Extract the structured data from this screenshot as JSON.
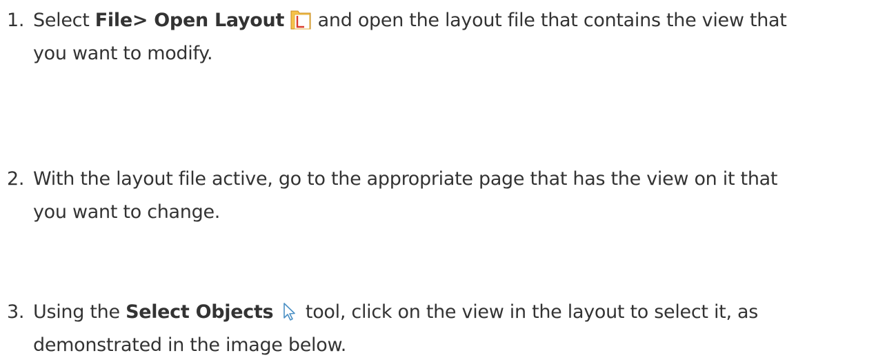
{
  "steps": [
    {
      "number": "1.",
      "before": "Select ",
      "command": "File> Open Layout",
      "icon": "open-layout-icon",
      "after": " and open the layout file that contains the view that",
      "continuation": "you want to modify."
    },
    {
      "number": "2.",
      "text": "With the layout file active, go to the appropriate page that has the view on it that",
      "continuation": "you want to change."
    },
    {
      "number": "3.",
      "before": "Using the ",
      "command": "Select Objects",
      "icon": "select-objects-arrow-icon",
      "after": " tool, click on the view in the layout to select it, as",
      "continuation": "demonstrated in the image below."
    }
  ],
  "colors": {
    "text": "#333333",
    "folder_fill": "#f6c24a",
    "folder_letter": "#d93a2b",
    "arrow_stroke": "#4a8fc4"
  }
}
